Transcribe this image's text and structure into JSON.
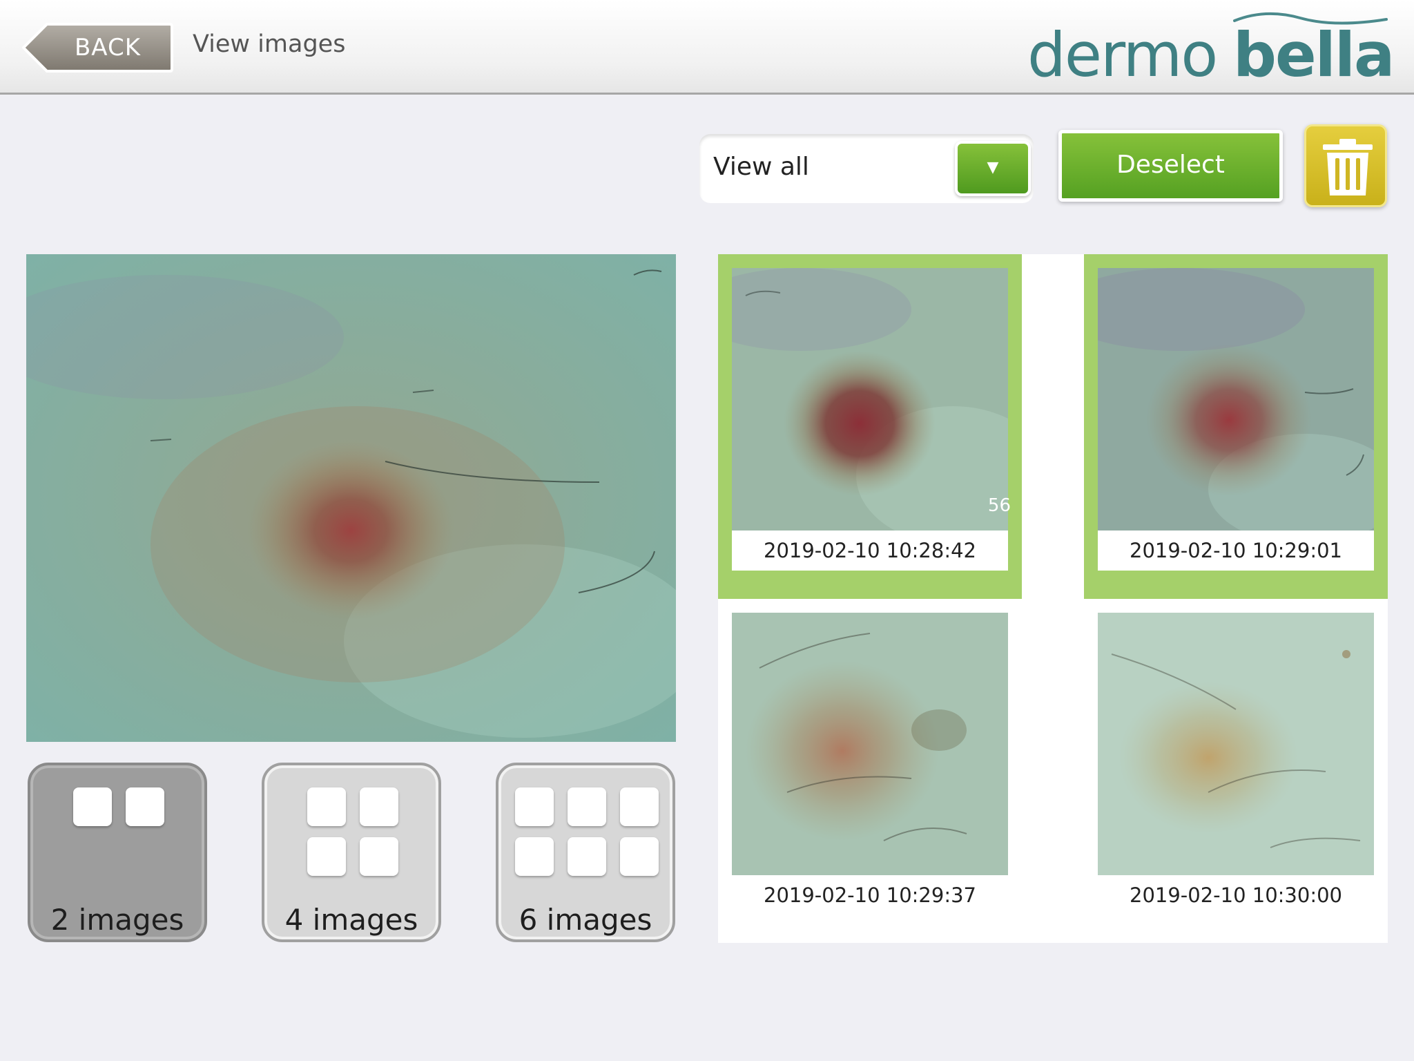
{
  "header": {
    "back_label": "BACK",
    "title": "View images",
    "logo_text_1": "dermo",
    "logo_text_2": "bella"
  },
  "toolbar": {
    "filter_value": "View all",
    "dropdown_icon": "triangle-down",
    "deselect_label": "Deselect",
    "delete_icon": "trash-icon"
  },
  "layouts": [
    {
      "label": "2 images",
      "active": true
    },
    {
      "label": "4 images",
      "active": false
    },
    {
      "label": "6 images",
      "active": false
    }
  ],
  "thumbnails": [
    {
      "timestamp": "2019-02-10 10:28:42",
      "selected": true,
      "badge": "56"
    },
    {
      "timestamp": "2019-02-10 10:29:01",
      "selected": true,
      "badge": ""
    },
    {
      "timestamp": "2019-02-10 10:29:37",
      "selected": false,
      "badge": ""
    },
    {
      "timestamp": "2019-02-10 10:30:00",
      "selected": false,
      "badge": ""
    }
  ],
  "colors": {
    "accent_green": "#6fb12e",
    "selection_border": "#a5d06a",
    "delete_yellow": "#d6be2a",
    "logo_teal": "#3f8083",
    "background": "#efeff4"
  }
}
